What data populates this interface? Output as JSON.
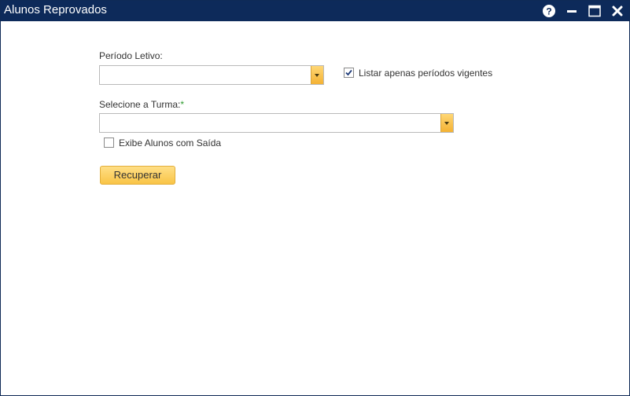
{
  "window": {
    "title": "Alunos Reprovados",
    "controls": [
      "help-icon",
      "minimize-icon",
      "maximize-icon",
      "close-icon"
    ],
    "title_bar_color": "#0d2a5a"
  },
  "form": {
    "periodo_label": "Período Letivo:",
    "periodo_value": "",
    "listar_vigentes_label": "Listar apenas períodos vigentes",
    "listar_vigentes_checked": true,
    "turma_label": "Selecione a Turma:",
    "turma_required_mark": "*",
    "turma_value": "",
    "exibe_saida_label": "Exibe Alunos com Saída",
    "exibe_saida_checked": false,
    "submit_label": "Recuperar"
  },
  "colors": {
    "accent": "#f9c446",
    "required": "#2e9a2e"
  }
}
